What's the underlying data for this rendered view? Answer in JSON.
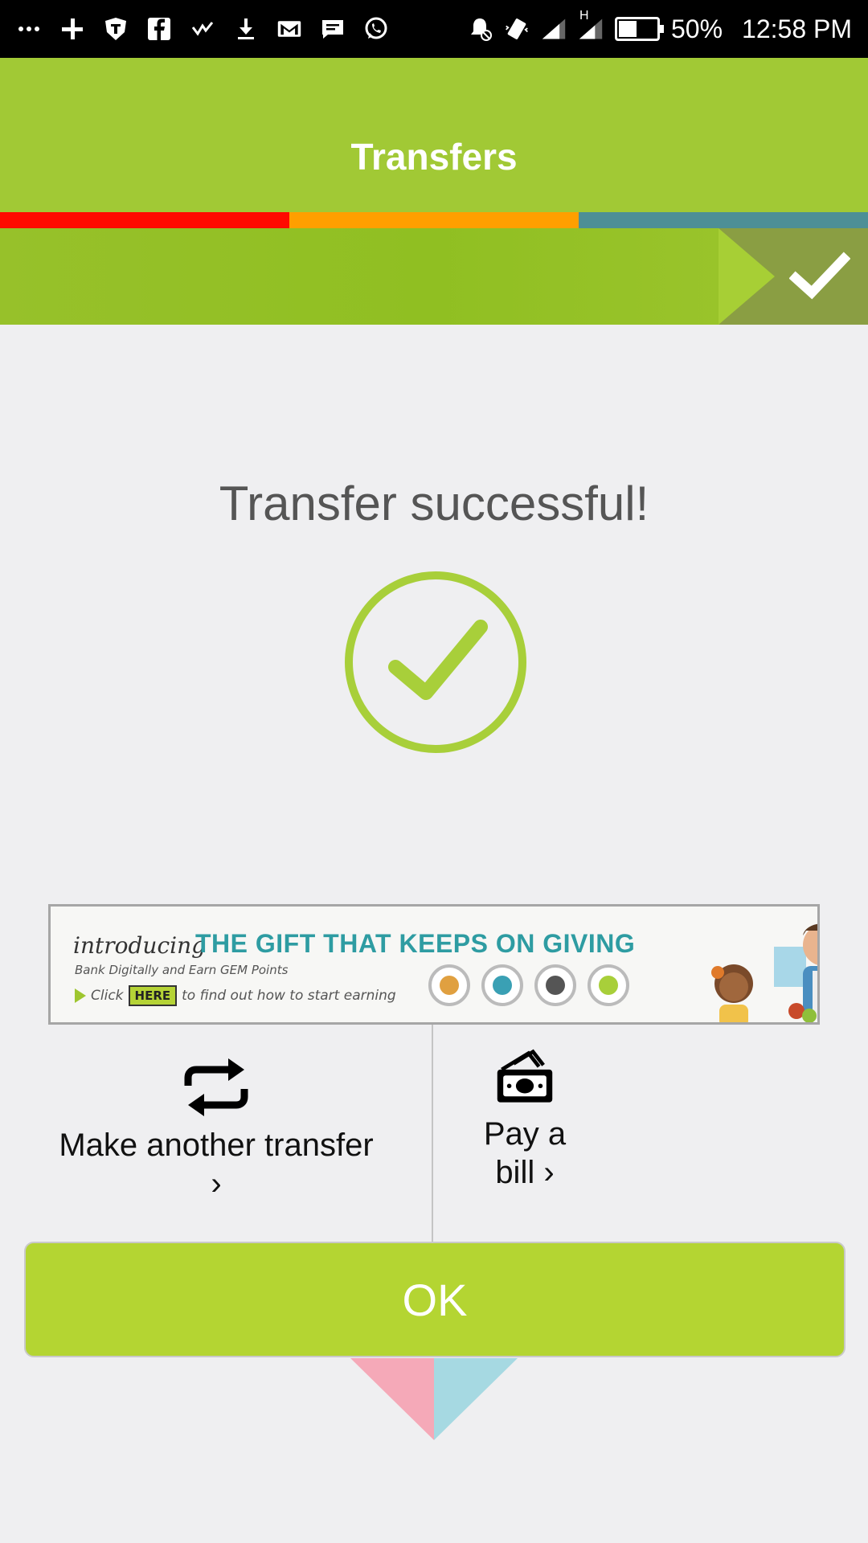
{
  "status_bar": {
    "battery": "50%",
    "time": "12:58 PM",
    "network": "H",
    "icons": [
      "more-icon",
      "add-icon",
      "shield-icon",
      "facebook-icon",
      "check-icon",
      "download-icon",
      "gmail-icon",
      "message-icon",
      "whatsapp-icon",
      "alarm-off-icon",
      "vibrate-icon",
      "signal-icon",
      "signal-icon",
      "battery-icon"
    ]
  },
  "header": {
    "title": "Transfers",
    "stripe_colors": [
      "#ff0a00",
      "#ff9f00",
      "#4d8f96"
    ],
    "accent": "#a1c935"
  },
  "result": {
    "title": "Transfer successful!",
    "icon": "check-circle-icon",
    "color": "#a8cf3a"
  },
  "banner": {
    "intro": "introducing",
    "headline": "THE GIFT THAT KEEPS ON GIVING",
    "sub": "Bank Digitally and Earn GEM Points",
    "cta_prefix": "Click",
    "cta_here": "HERE",
    "cta_suffix": "to find out how to start earning"
  },
  "actions": {
    "transfer": {
      "label": "Make another transfer",
      "chevron": "›",
      "icon": "repeat-icon"
    },
    "bill": {
      "label_line1": "Pay a",
      "label_line2": "bill",
      "chevron": "›",
      "icon": "money-icon"
    }
  },
  "ok_button": {
    "label": "OK",
    "color": "#b4d532"
  }
}
